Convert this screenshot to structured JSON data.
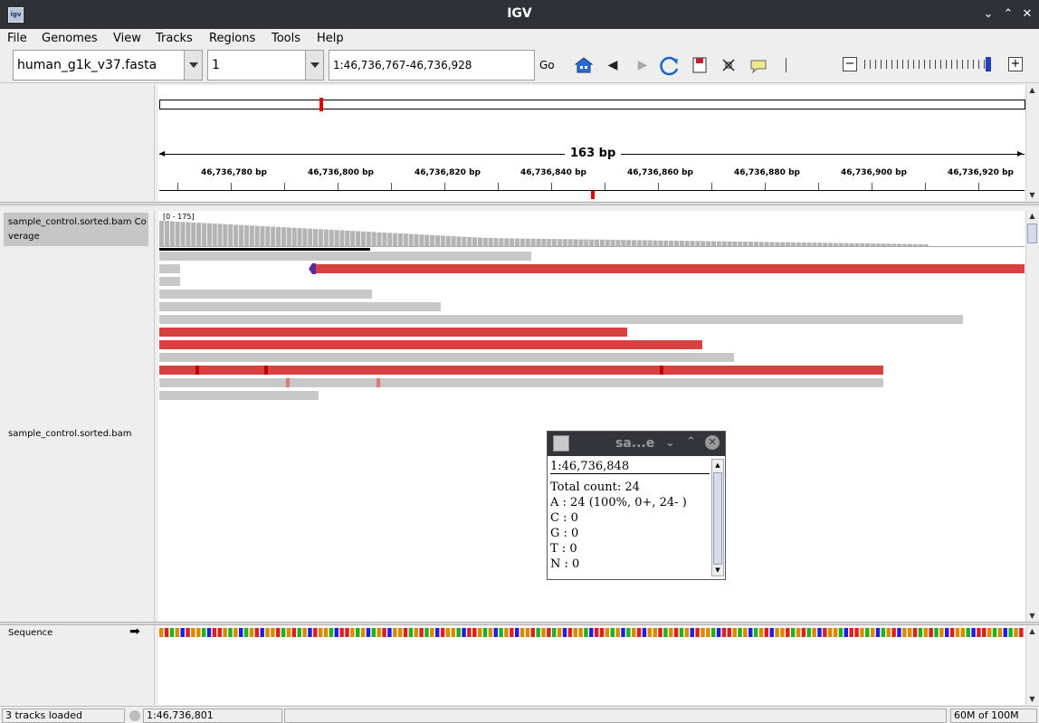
{
  "window": {
    "title": "IGV",
    "app_icon_text": "igv"
  },
  "menu": [
    "File",
    "Genomes",
    "View",
    "Tracks",
    "Regions",
    "Tools",
    "Help"
  ],
  "toolbar": {
    "genome": "human_g1k_v37.fasta",
    "chromosome": "1",
    "locus": "1:46,736,767-46,736,928",
    "go_label": "Go"
  },
  "ruler": {
    "span_label": "163 bp",
    "ticks": [
      "46,736,780 bp",
      "46,736,800 bp",
      "46,736,820 bp",
      "46,736,840 bp",
      "46,736,860 bp",
      "46,736,880 bp",
      "46,736,900 bp",
      "46,736,920 bp"
    ]
  },
  "tracks": {
    "coverage_label": "sample_control.sorted.bam Coverage",
    "coverage_range": "[0 - 175]",
    "alignment_label": "sample_control.sorted.bam",
    "sequence_label": "Sequence",
    "sequence_arrow": "➡"
  },
  "popup": {
    "title": "sa...e",
    "position": "1:46,736,848",
    "lines": [
      "Total count: 24",
      "A : 24 (100%, 0+, 24- )",
      "C : 0",
      "G : 0",
      "T : 0",
      "N : 0"
    ]
  },
  "status": {
    "tracks_loaded": "3 tracks loaded",
    "cursor_position": "1:46,736,801",
    "memory": "60M of 100M"
  },
  "colors": {
    "mismatch_red": "#d94040",
    "read_grey": "#c8c8c8",
    "base_A": "#1fb21f",
    "base_C": "#1f1fdc",
    "base_G": "#d98a00",
    "base_T": "#dc1f1f"
  }
}
